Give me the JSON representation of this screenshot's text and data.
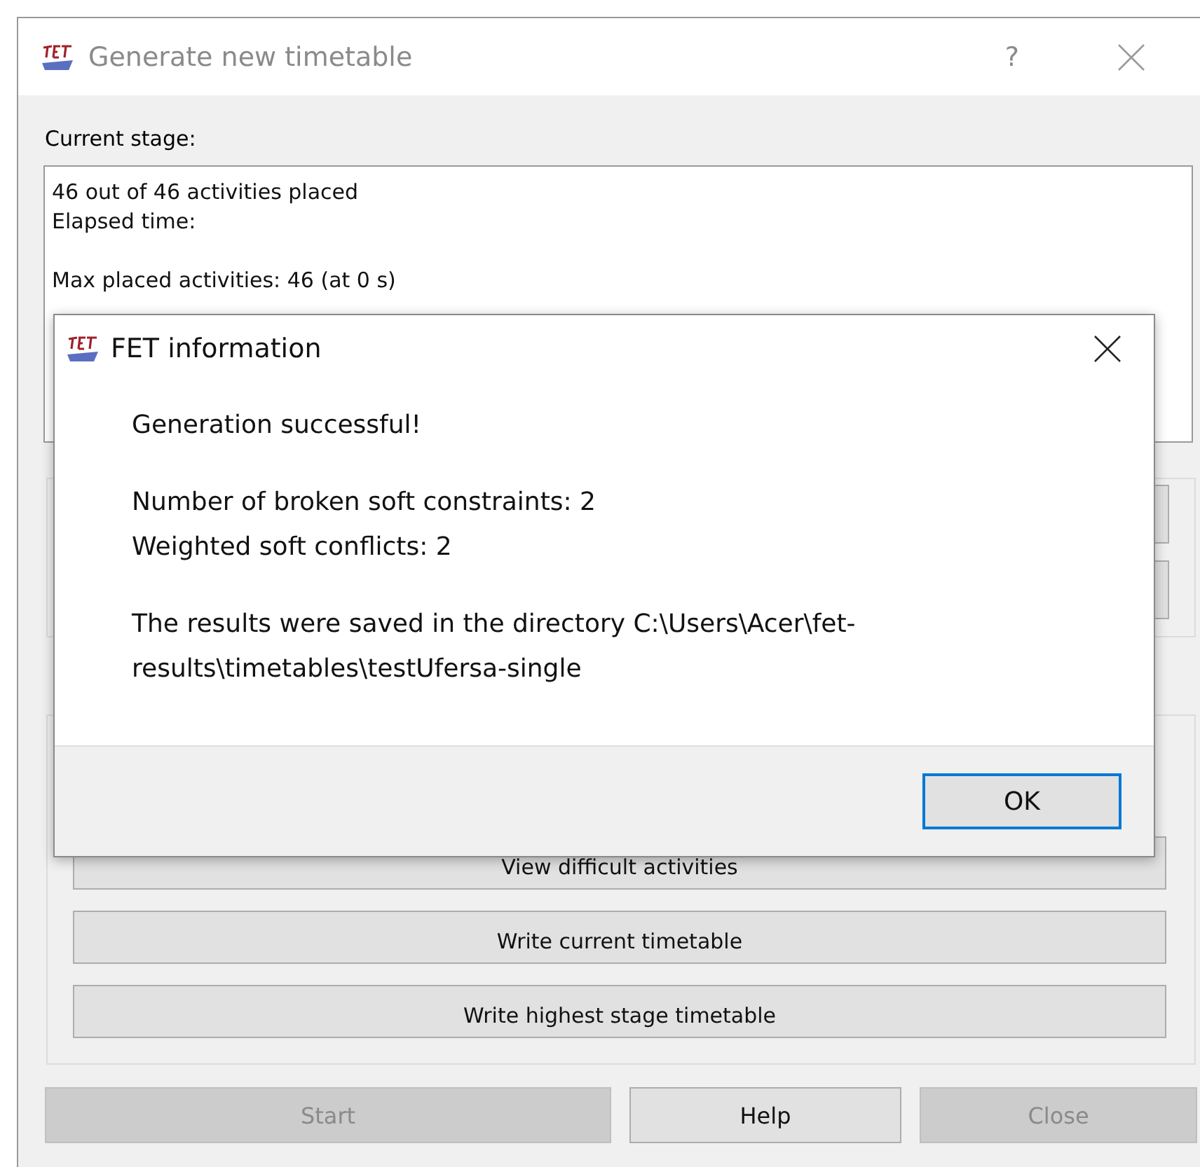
{
  "window": {
    "title": "Generate new timetable",
    "help_button": "?"
  },
  "current_stage": {
    "label": "Current stage:",
    "paragraphs": [
      [
        "46 out of 46 activities placed",
        "Elapsed time:"
      ],
      [
        "Max placed activities: 46 (at 0 s)"
      ]
    ]
  },
  "action_buttons": [
    "View difficult activities",
    "Write current timetable",
    "Write highest stage timetable"
  ],
  "footer_buttons": [
    {
      "label": "Start",
      "disabled": true
    },
    {
      "label": "Help",
      "disabled": false
    },
    {
      "label": "Close",
      "disabled": true
    }
  ],
  "dialog": {
    "title": "FET information",
    "paragraphs": [
      "Generation successful!",
      "Number of broken soft constraints: 2\nWeighted soft conflicts: 2",
      "The results were saved in the directory C:\\Users\\Acer\\fet-\nresults\\timetables\\testUfersa-single"
    ],
    "ok_button": {
      "label": "OK",
      "focused": true
    }
  }
}
